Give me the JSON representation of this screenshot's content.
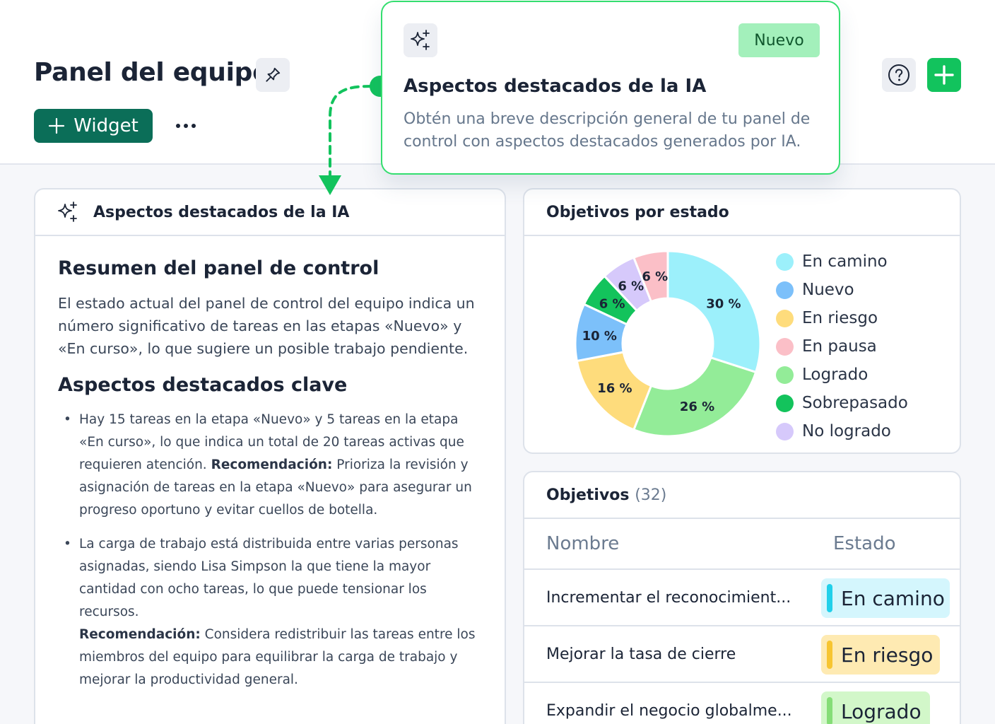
{
  "header": {
    "title": "Panel del equipo",
    "widget_button": "Widget"
  },
  "callout": {
    "badge": "Nuevo",
    "title": "Aspectos destacados de la IA",
    "description": "Obtén una breve descripción general de tu panel de control con aspectos destacados generados por IA.",
    "border_color": "#34de6f"
  },
  "ai_card": {
    "title": "Aspectos destacados de la IA",
    "summary_heading": "Resumen del panel de control",
    "summary_text": "El estado actual del panel de control del equipo indica un número significativo de tareas en las etapas «Nuevo» y «En curso», lo que sugiere un posible trabajo pendiente.",
    "key_heading": "Aspectos destacados clave",
    "bullets": [
      {
        "text": "Hay 15 tareas en la etapa «Nuevo» y 5 tareas en la etapa «En curso», lo que indica un total de 20 tareas activas que requieren atención.",
        "rec_label": "Recomendación:",
        "rec_text": "Prioriza la revisión y asignación de tareas en la etapa «Nuevo» para asegurar un progreso oportuno y evitar cuellos de botella."
      },
      {
        "text": "La carga de trabajo está distribuida entre varias personas asignadas, siendo Lisa Simpson la que tiene la mayor cantidad con ocho tareas, lo que puede tensionar los recursos.",
        "rec_label": "Recomendación:",
        "rec_text": "Considera redistribuir las tareas entre los miembros del equipo para equilibrar la carga de trabajo y mejorar la productividad general."
      }
    ]
  },
  "chart_card": {
    "title": "Objetivos por estado"
  },
  "chart_data": {
    "type": "pie",
    "categories": [
      "En camino",
      "Nuevo",
      "En riesgo",
      "En pausa",
      "Logrado",
      "Sobrepasado",
      "No logrado"
    ],
    "values": [
      30,
      10,
      16,
      6,
      26,
      6,
      6
    ],
    "labels": [
      "30 %",
      "10 %",
      "16 %",
      "6 %",
      "26 %",
      "6 %",
      "6 %"
    ],
    "order": [
      "En camino",
      "Logrado",
      "En riesgo",
      "Nuevo",
      "Sobrepasado",
      "No logrado",
      "En pausa"
    ],
    "colors": {
      "En camino": "#9cf0fb",
      "Nuevo": "#7cc0fa",
      "En riesgo": "#fedc7c",
      "En pausa": "#fbbfc7",
      "Logrado": "#93ec98",
      "Sobrepasado": "#13c35c",
      "No logrado": "#d6c9fb"
    },
    "legend_position": "right"
  },
  "table_card": {
    "title": "Objetivos",
    "count": "(32)",
    "col_name": "Nombre",
    "col_status": "Estado",
    "rows": [
      {
        "name": "Incrementar el reconocimient...",
        "status": "En camino",
        "bg": "#d4f6fd",
        "bar": "#21d0ea"
      },
      {
        "name": "Mejorar la tasa de cierre",
        "status": "En riesgo",
        "bg": "#feeab2",
        "bar": "#f7c531"
      },
      {
        "name": "Expandir el negocio globalme...",
        "status": "Logrado",
        "bg": "#d2f7c9",
        "bar": "#85dd77"
      }
    ]
  }
}
